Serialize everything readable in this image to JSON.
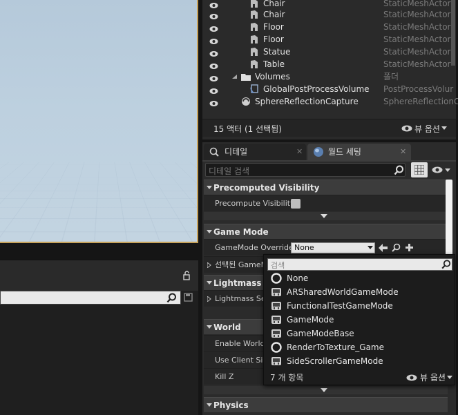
{
  "outliner": {
    "rows": [
      {
        "name": "Chair",
        "type": "StaticMeshActor"
      },
      {
        "name": "Chair",
        "type": "StaticMeshActor"
      },
      {
        "name": "Floor",
        "type": "StaticMeshActor"
      },
      {
        "name": "Floor",
        "type": "StaticMeshActor"
      },
      {
        "name": "Statue",
        "type": "StaticMeshActor"
      },
      {
        "name": "Table",
        "type": "StaticMeshActor"
      },
      {
        "name": "Volumes",
        "type": "폴더"
      },
      {
        "name": "GlobalPostProcessVolume",
        "type": "PostProcessVolur"
      },
      {
        "name": "SphereReflectionCapture",
        "type": "SphereReflectionC"
      }
    ],
    "status": "15 액터 (1 선택됨)",
    "view_options": "뷰 옵션"
  },
  "details": {
    "tabs": [
      {
        "label": "디테일"
      },
      {
        "label": "월드 세팅"
      }
    ],
    "search_placeholder": "디테일 검색",
    "sections": {
      "precomputed": {
        "title": "Precomputed Visibility",
        "precompute_label": "Precompute Visibility"
      },
      "game_mode": {
        "title": "Game Mode",
        "override_label": "GameMode Override",
        "override_value": "None",
        "selected_label": "선택된 GameM"
      },
      "lightmass": {
        "title": "Lightmass",
        "settings_label": "Lightmass Se"
      },
      "world": {
        "title": "World",
        "enable_label": "Enable World C",
        "client_label": "Use Client Sid",
        "killz_label": "Kill Z"
      },
      "physics": {
        "title": "Physics"
      }
    }
  },
  "popup": {
    "search_placeholder": "검색",
    "items": [
      {
        "label": "None",
        "icon": "circle-icon"
      },
      {
        "label": "ARSharedWorldGameMode",
        "icon": "class-icon"
      },
      {
        "label": "FunctionalTestGameMode",
        "icon": "class-icon"
      },
      {
        "label": "GameMode",
        "icon": "class-icon"
      },
      {
        "label": "GameModeBase",
        "icon": "class-icon"
      },
      {
        "label": "RenderToTexture_Game",
        "icon": "circle-icon"
      },
      {
        "label": "SideScrollerGameMode",
        "icon": "class-icon"
      }
    ],
    "count": "7 개 항목",
    "view_options": "뷰 옵션"
  }
}
